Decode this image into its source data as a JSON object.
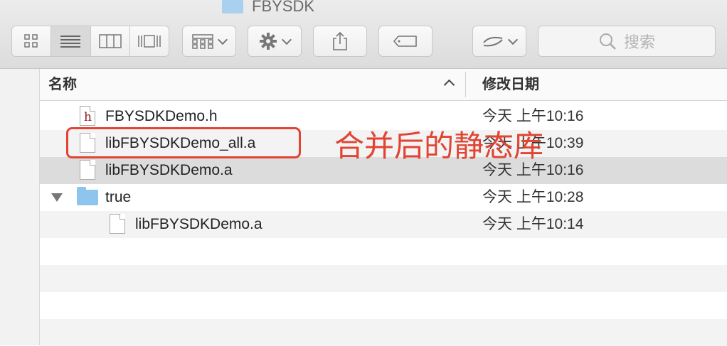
{
  "window": {
    "title": "FBYSDK"
  },
  "toolbar": {
    "view_modes": [
      "icon-view",
      "list-view",
      "column-view",
      "cover-flow-view"
    ],
    "active_view": "list-view",
    "search_placeholder": "搜索"
  },
  "header": {
    "name_col": "名称",
    "date_col": "修改日期"
  },
  "files": [
    {
      "name": "FBYSDKDemo.h",
      "date": "今天 上午10:16",
      "kind": "header-file"
    },
    {
      "name": "libFBYSDKDemo_all.a",
      "date": "今天 上午10:39",
      "kind": "file"
    },
    {
      "name": "libFBYSDKDemo.a",
      "date": "今天 上午10:16",
      "kind": "file",
      "selected": true
    },
    {
      "name": "true",
      "date": "今天 上午10:28",
      "kind": "folder",
      "expanded": true
    },
    {
      "name": "libFBYSDKDemo.a",
      "date": "今天 上午10:14",
      "kind": "file",
      "indent": 1
    }
  ],
  "annotation": {
    "text": "合并后的静态库",
    "color": "#e14433"
  }
}
